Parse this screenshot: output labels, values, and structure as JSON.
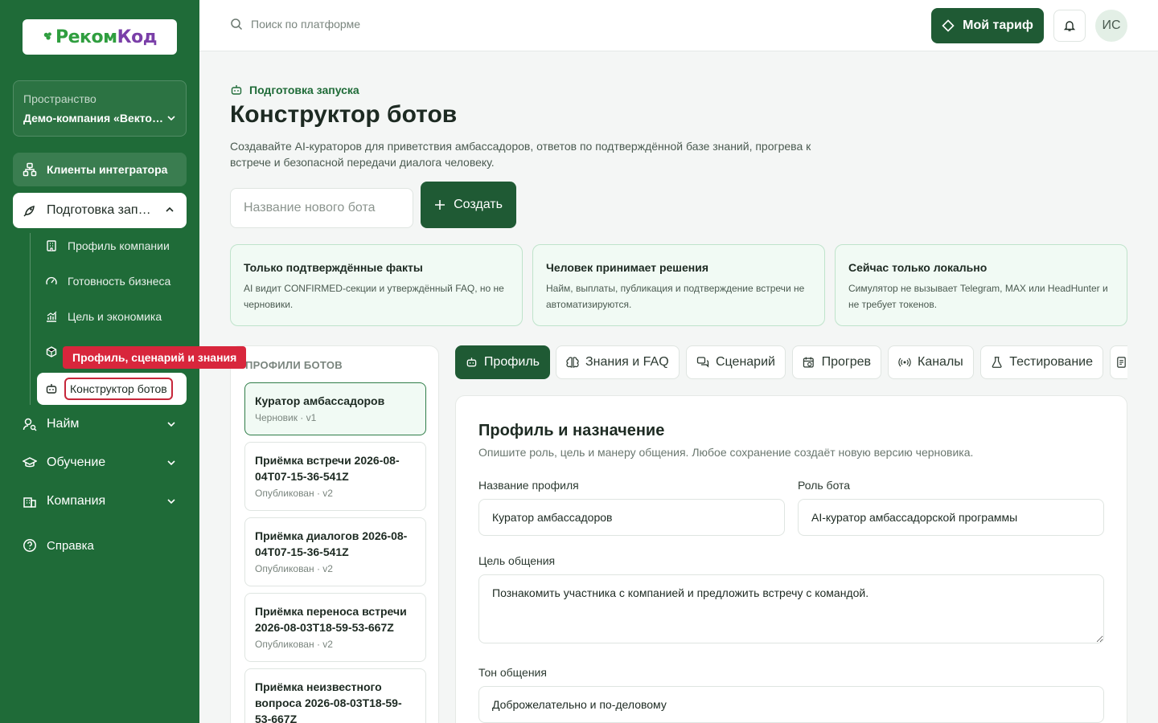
{
  "logo": {
    "part1": "Реком",
    "part2": "Код"
  },
  "sidebar": {
    "space_label": "Пространство",
    "space_value": "Демо-компания «Вектор»",
    "integrator": "Клиенты интегратора",
    "prep": "Подготовка запуска",
    "sub_items": [
      "Профиль компании",
      "Готовность бизнеса",
      "Цель и экономика"
    ],
    "tooltip": "Профиль, сценарий и знания",
    "active_sub": "Конструктор ботов",
    "main_items": [
      "Найм",
      "Обучение",
      "Компания"
    ],
    "help": "Справка"
  },
  "topbar": {
    "search_placeholder": "Поиск по платформе",
    "tariff": "Мой тариф",
    "avatar": "ИС"
  },
  "page": {
    "crumb": "Подготовка запуска",
    "title": "Конструктор ботов",
    "description": "Создавайте AI-кураторов для приветствия амбассадоров, ответов по подтверждённой базе знаний, прогрева к встрече и безопасной передачи диалога человеку.",
    "new_placeholder": "Название нового бота",
    "create": "Создать"
  },
  "info_cards": [
    {
      "title": "Только подтверждённые факты",
      "text": "AI видит CONFIRMED-секции и утверждённый FAQ, но не черновики."
    },
    {
      "title": "Человек принимает решения",
      "text": "Найм, выплаты, публикация и подтверждение встречи не автоматизируются."
    },
    {
      "title": "Сейчас только локально",
      "text": "Симулятор не вызывает Telegram, MAX или HeadHunter и не требует токенов."
    }
  ],
  "profiles": {
    "heading": "ПРОФИЛИ БОТОВ",
    "items": [
      {
        "name": "Куратор амбассадоров",
        "status": "Черновик · v1"
      },
      {
        "name": "Приёмка встречи 2026-08-04T07-15-36-541Z",
        "status": "Опубликован · v2"
      },
      {
        "name": "Приёмка диалогов 2026-08-04T07-15-36-541Z",
        "status": "Опубликован · v2"
      },
      {
        "name": "Приёмка переноса встречи 2026-08-03T18-59-53-667Z",
        "status": "Опубликован · v2"
      },
      {
        "name": "Приёмка неизвестного вопроса 2026-08-03T18-59-53-667Z",
        "status": ""
      }
    ]
  },
  "tabs": [
    "Профиль",
    "Знания и FAQ",
    "Сценарий",
    "Прогрев",
    "Каналы",
    "Тестирование"
  ],
  "form": {
    "title": "Профиль и назначение",
    "description": "Опишите роль, цель и манеру общения. Любое сохранение создаёт новую версию черновика.",
    "name_label": "Название профиля",
    "name_value": "Куратор амбассадоров",
    "role_label": "Роль бота",
    "role_value": "AI-куратор амбассадорской программы",
    "goal_label": "Цель общения",
    "goal_value": "Познакомить участника с компанией и предложить встречу с командой.",
    "tone_label": "Тон общения",
    "tone_value": "Доброжелательно и по-деловому"
  },
  "colors": {
    "sidebar": "#1f6b38",
    "accent": "#1f5a34",
    "highlight": "#d8263c"
  }
}
